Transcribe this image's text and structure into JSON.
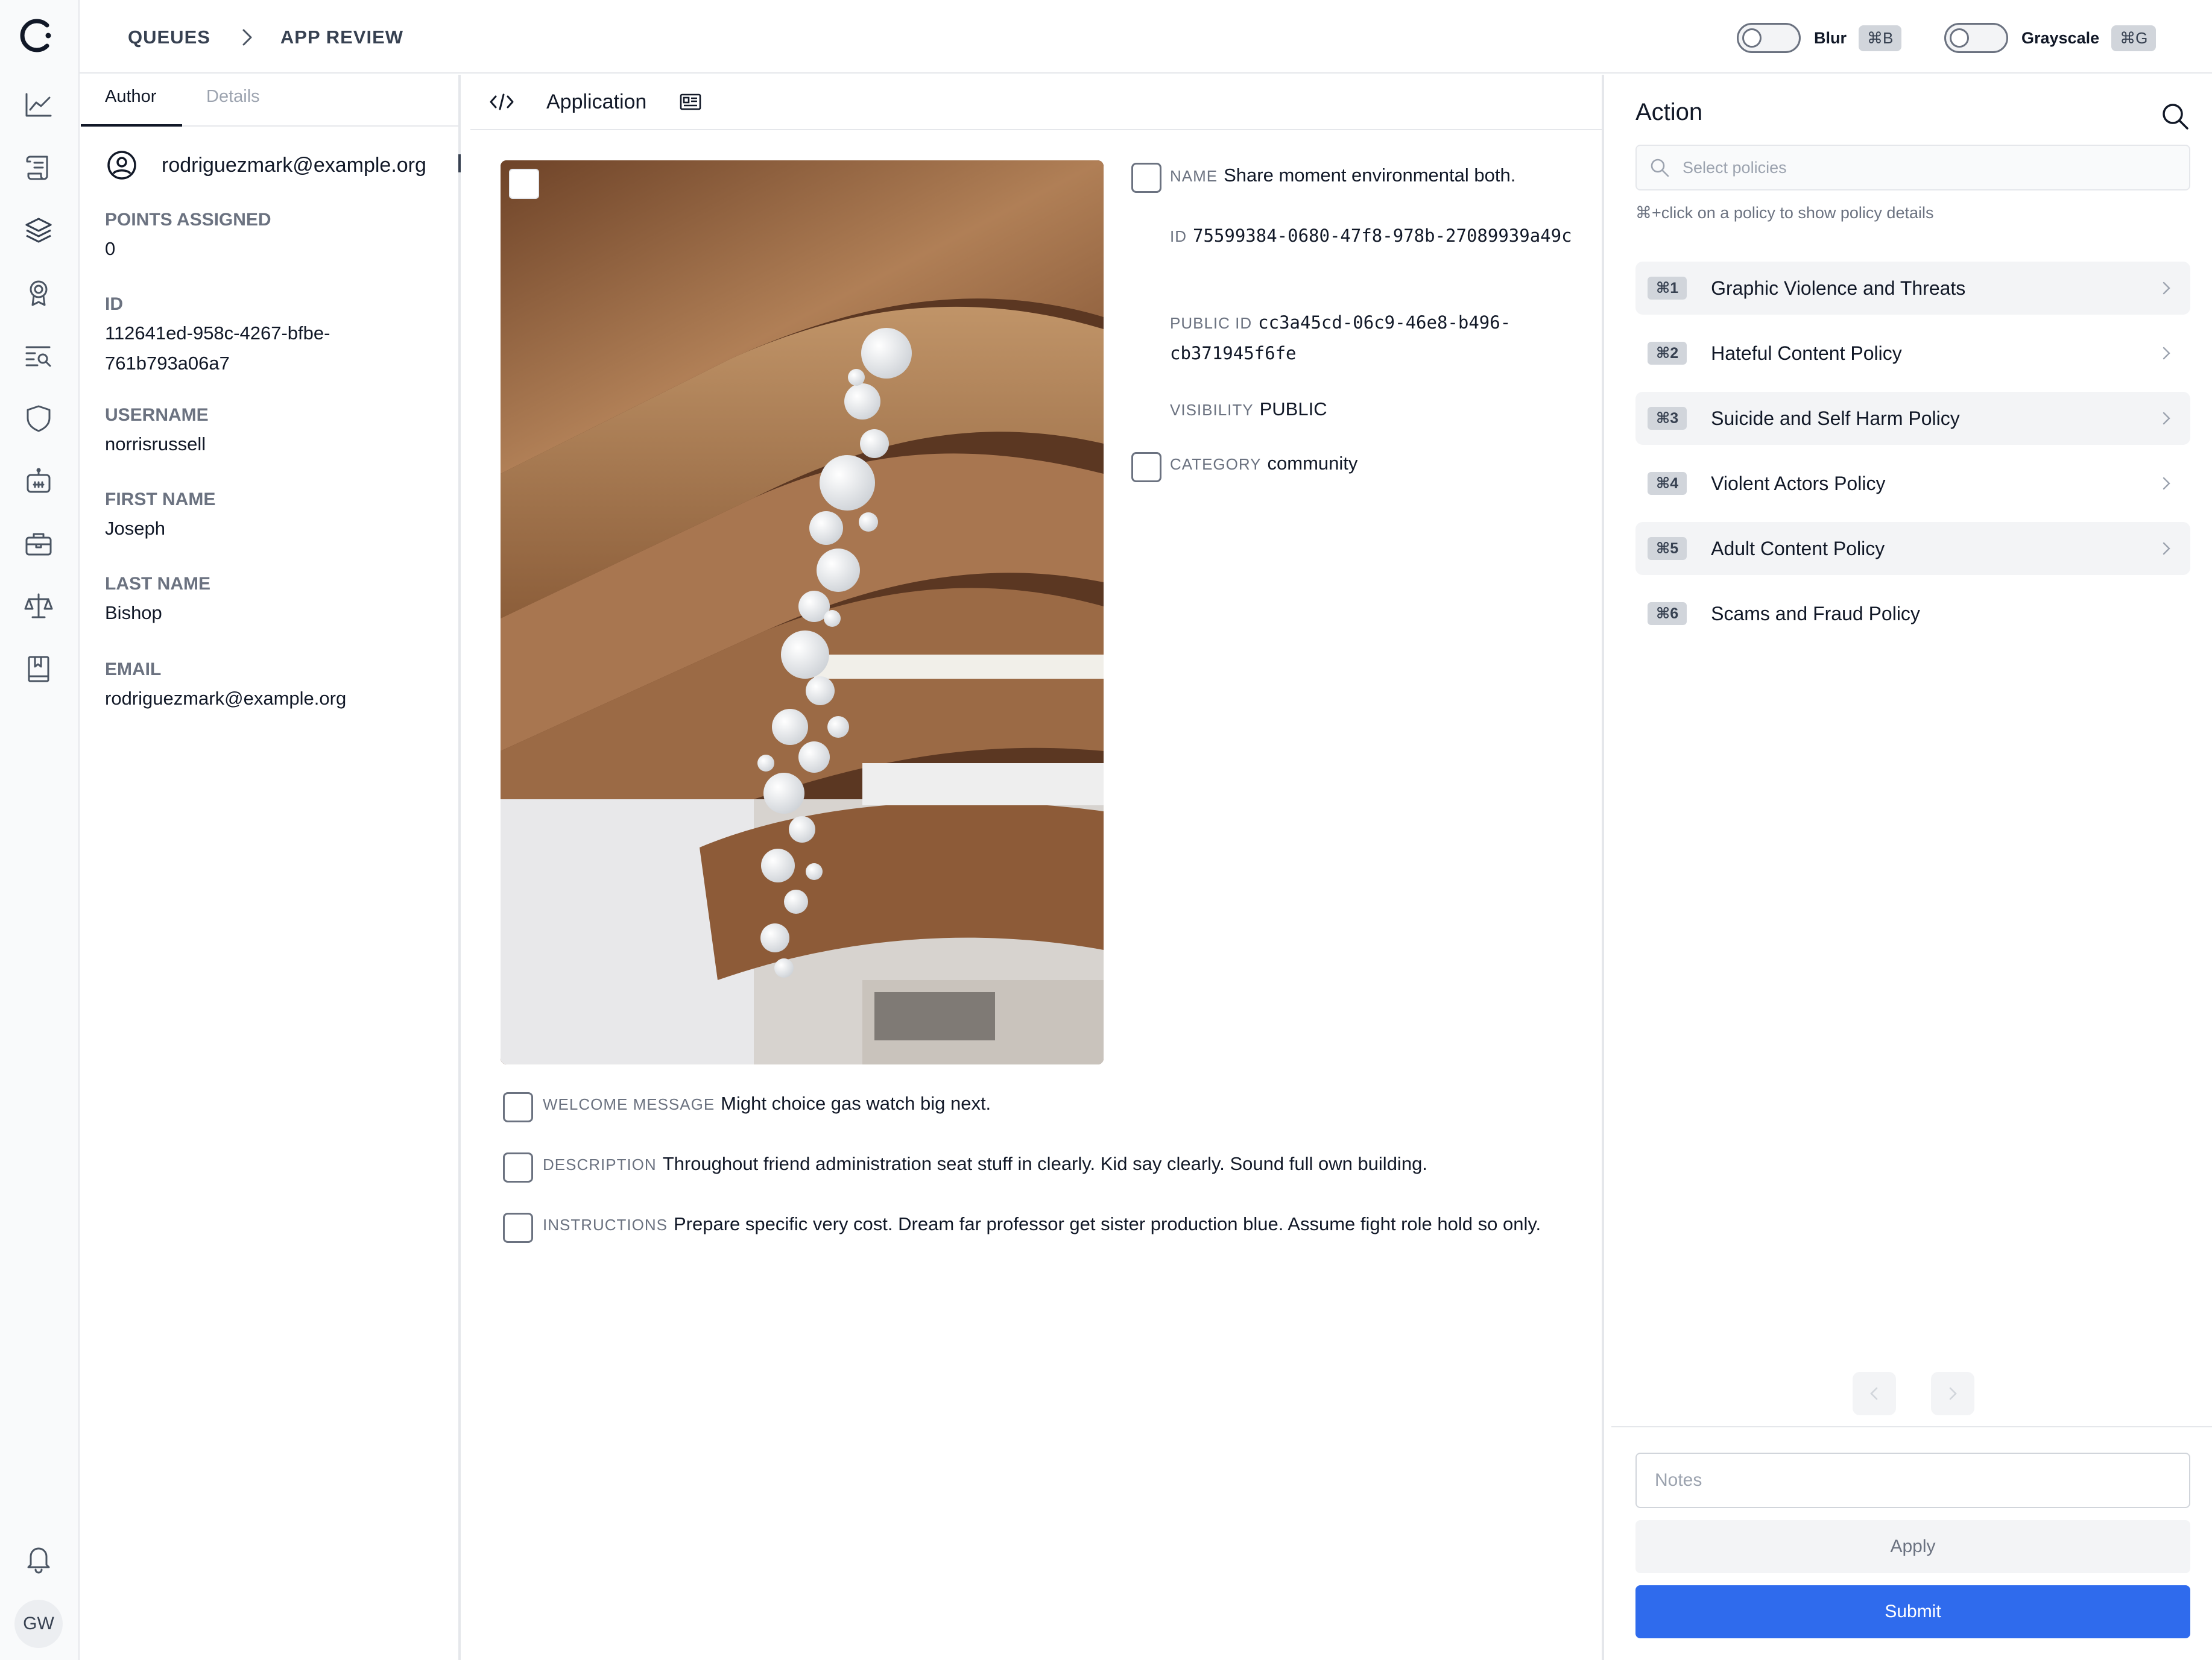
{
  "rail": {
    "items": [
      "chart-line-icon",
      "scroll-icon",
      "layers-icon",
      "award-icon",
      "search-list-icon",
      "shield-icon",
      "robot-icon",
      "briefcase-icon",
      "scale-icon",
      "bookmark-book-icon"
    ],
    "bell_icon": "bell-icon",
    "avatar_initials": "GW"
  },
  "breadcrumb": {
    "items": [
      "QUEUES",
      "APP REVIEW"
    ]
  },
  "toggles": {
    "blur": {
      "label": "Blur",
      "shortcut": "⌘B",
      "on": false
    },
    "grayscale": {
      "label": "Grayscale",
      "shortcut": "⌘G",
      "on": false
    }
  },
  "author_panel": {
    "tabs": [
      "Author",
      "Details"
    ],
    "active_tab": "Author",
    "header_email": "rodriguezmark@example.org",
    "fields": [
      {
        "label": "POINTS ASSIGNED",
        "value": "0"
      },
      {
        "label": "ID",
        "value": "112641ed-958c-4267-bfbe-761b793a06a7"
      },
      {
        "label": "USERNAME",
        "value": "norrisrussell"
      },
      {
        "label": "FIRST NAME",
        "value": "Joseph"
      },
      {
        "label": "LAST NAME",
        "value": "Bishop"
      },
      {
        "label": "EMAIL",
        "value": "rodriguezmark@example.org"
      }
    ]
  },
  "application": {
    "title": "Application",
    "properties": {
      "name": {
        "label": "NAME",
        "value": "Share moment environmental both."
      },
      "id": {
        "label": "ID",
        "value": "75599384-0680-47f8-978b-27089939a49c"
      },
      "public_id": {
        "label": "PUBLIC ID",
        "value": "cc3a45cd-06c9-46e8-b496-cb371945f6fe"
      },
      "visibility": {
        "label": "VISIBILITY",
        "value": "PUBLIC"
      },
      "category": {
        "label": "CATEGORY",
        "value": "community"
      },
      "welcome_message": {
        "label": "WELCOME MESSAGE",
        "value": "Might choice gas watch big next."
      },
      "description": {
        "label": "DESCRIPTION",
        "value": "Throughout friend administration seat stuff in clearly. Kid say clearly. Sound full own building."
      },
      "instructions": {
        "label": "INSTRUCTIONS",
        "value": "Prepare specific very cost. Dream far professor get sister production blue. Assume fight role hold so only."
      }
    }
  },
  "action_panel": {
    "title": "Action",
    "search_placeholder": "Select policies",
    "hint": "⌘+click on a policy to show policy details",
    "policies": [
      {
        "shortcut": "⌘1",
        "label": "Graphic Violence and Threats"
      },
      {
        "shortcut": "⌘2",
        "label": "Hateful Content Policy"
      },
      {
        "shortcut": "⌘3",
        "label": "Suicide and Self Harm Policy"
      },
      {
        "shortcut": "⌘4",
        "label": "Violent Actors Policy"
      },
      {
        "shortcut": "⌘5",
        "label": "Adult Content Policy"
      },
      {
        "shortcut": "⌘6",
        "label": "Scams and Fraud Policy"
      }
    ],
    "notes_placeholder": "Notes",
    "apply_label": "Apply",
    "submit_label": "Submit"
  },
  "colors": {
    "primary": "#2f6bed",
    "border": "#e5e7eb",
    "muted_text": "#6b7280",
    "shaded_row": "#f3f4f6"
  }
}
